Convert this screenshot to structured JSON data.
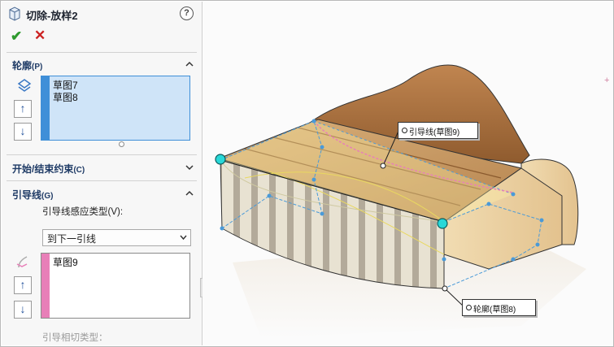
{
  "title": "切除-放样2",
  "help_symbol": "?",
  "icons": {
    "title": "loft-cut-icon",
    "ok": "check-icon",
    "cancel": "close-icon",
    "profile": "profile-icon",
    "guide": "guide-curve-icon"
  },
  "colors": {
    "accent_blue": "#3f8fd8",
    "guide_pink": "#e87fb8",
    "ok_green": "#2e9a2e",
    "cancel_red": "#cc2222",
    "section_text": "#1f3b66",
    "preview_blue": "#4a9ad8",
    "handle_cyan": "#28d8d8"
  },
  "profiles": {
    "label": "轮廓",
    "key": "(P)",
    "items": [
      "草图7",
      "草图8"
    ],
    "expanded": true
  },
  "start_end": {
    "label": "开始/结束约束",
    "key": "(C)",
    "expanded": false
  },
  "guides": {
    "label": "引导线",
    "key": "(G)",
    "expanded": true,
    "influence_label": "引导线感应类型(V):",
    "influence_value": "到下一引线",
    "items": [
      "草图9"
    ],
    "tangency_label": "引导相切类型："
  },
  "controls": {
    "ok": "✔",
    "cancel": "✕",
    "up": "↑",
    "down": "↓"
  },
  "viewport": {
    "callout_guide": "引导线(草图9)",
    "callout_profile": "轮廓(草图8)",
    "plus": "+"
  }
}
